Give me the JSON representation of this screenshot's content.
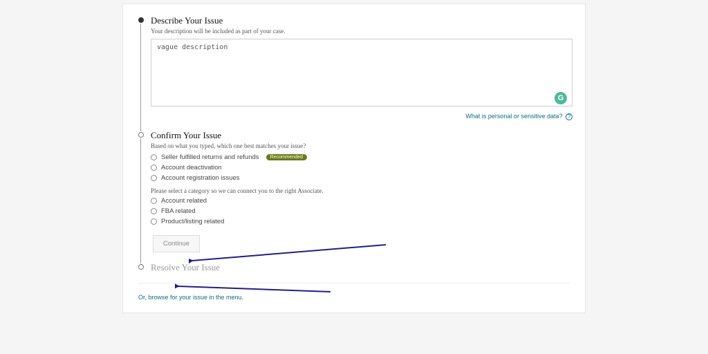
{
  "step1": {
    "title": "Describe Your Issue",
    "subtitle": "Your description will be included as part of your case.",
    "textarea_value": "vague description",
    "sensitive_link": "What is personal or sensitive data?",
    "grammarly_letter": "G"
  },
  "step2": {
    "title": "Confirm Your Issue",
    "subtitle": "Based on what you typed, which one best matches your issue?",
    "recommended_badge": "Recommended",
    "suggestions": [
      "Seller fulfilled returns and refunds",
      "Account deactivation",
      "Account registration issues"
    ],
    "category_prompt": "Please select a category so we can connect you to the right Associate.",
    "categories": [
      "Account related",
      "FBA related",
      "Product/listing related"
    ],
    "continue_label": "Continue"
  },
  "step3": {
    "title": "Resolve Your Issue"
  },
  "footer": {
    "browse_link": "Or, browse for your issue in the menu."
  }
}
